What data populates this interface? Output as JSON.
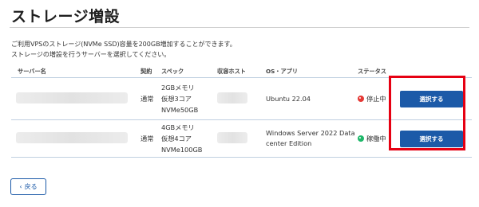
{
  "page": {
    "title": "ストレージ増設",
    "description_line1": "ご利用VPSのストレージ(NVMe SSD)容量を200GB増加することができます。",
    "description_line2": "ストレージの増設を行うサーバーを選択してください。"
  },
  "table": {
    "headers": {
      "server_name": "サーバー名",
      "contract": "契約",
      "spec": "スペック",
      "host": "収容ホスト",
      "os": "OS・アプリ",
      "status": "ステータス"
    },
    "rows": [
      {
        "contract": "通常",
        "spec_memory": "2GBメモリ",
        "spec_cpu": "仮想3コア",
        "spec_disk": "NVMe50GB",
        "os_line1": "Ubuntu 22.04",
        "os_line2": "",
        "status": "停止中",
        "status_color": "#e53935",
        "select_label": "選択する"
      },
      {
        "contract": "通常",
        "spec_memory": "4GBメモリ",
        "spec_cpu": "仮想4コア",
        "spec_disk": "NVMe100GB",
        "os_line1": "Windows Server 2022 Data",
        "os_line2": "center Edition",
        "status": "稼働中",
        "status_color": "#1fb86a",
        "select_label": "選択する"
      }
    ]
  },
  "back_button": {
    "label": "戻る"
  },
  "colors": {
    "accent": "#1c5aa8",
    "highlight": "#e60012"
  }
}
